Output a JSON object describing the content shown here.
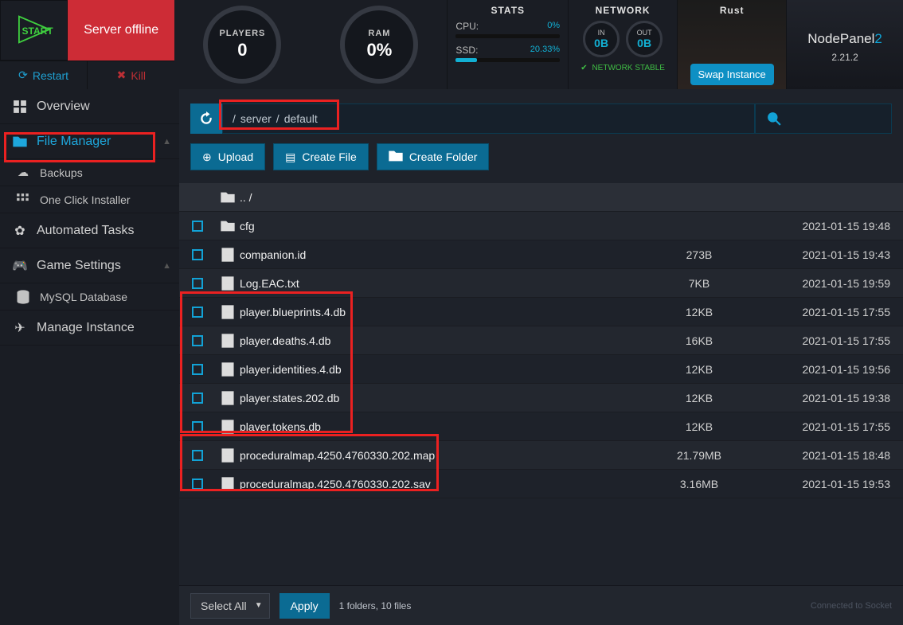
{
  "server_status": "Server offline",
  "start_label": "START",
  "restart_label": "Restart",
  "kill_label": "Kill",
  "gauges": {
    "players": {
      "label": "PLAYERS",
      "value": "0"
    },
    "ram": {
      "label": "RAM",
      "value": "0%"
    }
  },
  "stats": {
    "title": "STATS",
    "cpu": {
      "label": "CPU:",
      "pct": "0%",
      "fill": 0
    },
    "ssd": {
      "label": "SSD:",
      "pct": "20.33%",
      "fill": 20.33
    }
  },
  "network": {
    "title": "NETWORK",
    "in": {
      "dir": "IN",
      "val": "0B"
    },
    "out": {
      "dir": "OUT",
      "val": "0B"
    },
    "status": "NETWORK STABLE"
  },
  "game": {
    "title": "Rust",
    "swap_label": "Swap Instance"
  },
  "brand": {
    "name1": "NodePanel",
    "name2": "2",
    "version": "2.21.2"
  },
  "sidebar": {
    "overview": "Overview",
    "file_manager": "File Manager",
    "backups": "Backups",
    "one_click": "One Click Installer",
    "automated": "Automated Tasks",
    "game_settings": "Game Settings",
    "mysql": "MySQL Database",
    "manage_instance": "Manage Instance"
  },
  "breadcrumb": {
    "parts": [
      "server",
      "default"
    ]
  },
  "actions": {
    "upload": "Upload",
    "create_file": "Create File",
    "create_folder": "Create Folder"
  },
  "parent_label": ".. /",
  "files": [
    {
      "type": "folder",
      "name": "cfg",
      "size": "",
      "date": "2021-01-15 19:48"
    },
    {
      "type": "file",
      "name": "companion.id",
      "size": "273B",
      "date": "2021-01-15 19:43"
    },
    {
      "type": "file",
      "name": "Log.EAC.txt",
      "size": "7KB",
      "date": "2021-01-15 19:59"
    },
    {
      "type": "file",
      "name": "player.blueprints.4.db",
      "size": "12KB",
      "date": "2021-01-15 17:55"
    },
    {
      "type": "file",
      "name": "player.deaths.4.db",
      "size": "16KB",
      "date": "2021-01-15 17:55"
    },
    {
      "type": "file",
      "name": "player.identities.4.db",
      "size": "12KB",
      "date": "2021-01-15 19:56"
    },
    {
      "type": "file",
      "name": "player.states.202.db",
      "size": "12KB",
      "date": "2021-01-15 19:38"
    },
    {
      "type": "file",
      "name": "player.tokens.db",
      "size": "12KB",
      "date": "2021-01-15 17:55"
    },
    {
      "type": "file",
      "name": "proceduralmap.4250.4760330.202.map",
      "size": "21.79MB",
      "date": "2021-01-15 18:48"
    },
    {
      "type": "file",
      "name": "proceduralmap.4250.4760330.202.sav",
      "size": "3.16MB",
      "date": "2021-01-15 19:53"
    }
  ],
  "footer": {
    "select_all": "Select All",
    "apply": "Apply",
    "count": "1 folders, 10 files",
    "socket": "Connected to Socket"
  }
}
